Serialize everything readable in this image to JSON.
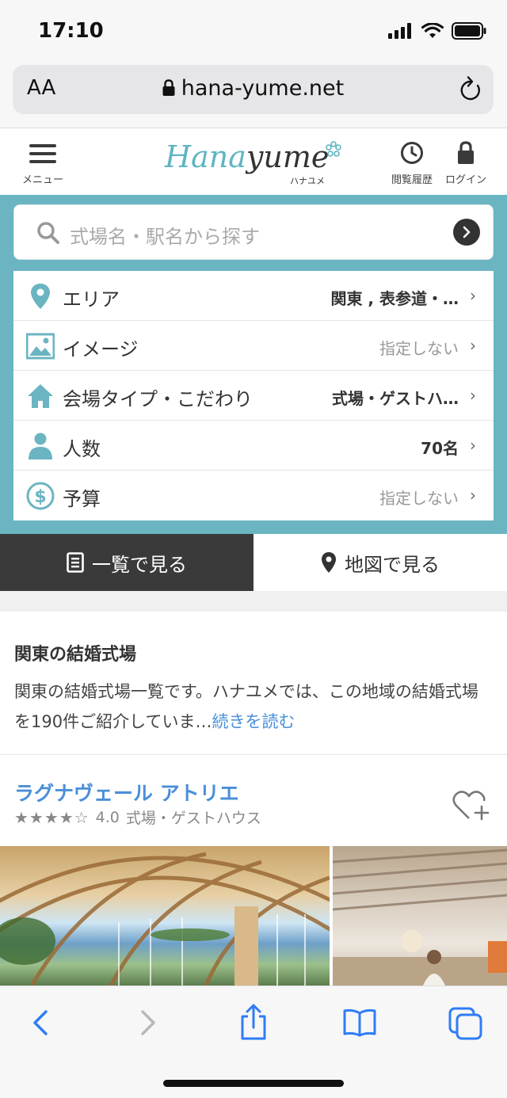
{
  "status_bar": {
    "time": "17:10"
  },
  "browser": {
    "text_size_label": "AA",
    "url": "hana-yume.net"
  },
  "site_header": {
    "menu_label": "メニュー",
    "logo_main": "Hana",
    "logo_accent": "yume",
    "logo_sub": "ハナユメ",
    "history_label": "閲覧履歴",
    "login_label": "ログイン"
  },
  "search": {
    "placeholder": "式場名・駅名から探す"
  },
  "filters": [
    {
      "label": "エリア",
      "value": "関東 , 表参道・…",
      "muted": false,
      "icon": "map-pin-icon"
    },
    {
      "label": "イメージ",
      "value": "指定しない",
      "muted": true,
      "icon": "image-icon"
    },
    {
      "label": "会場タイプ・こだわり",
      "value": "式場・ゲストハ…",
      "muted": false,
      "icon": "home-icon"
    },
    {
      "label": "人数",
      "value": "70名",
      "muted": false,
      "icon": "person-icon"
    },
    {
      "label": "予算",
      "value": "指定しない",
      "muted": true,
      "icon": "dollar-icon"
    }
  ],
  "tabs": {
    "list_label": "一覧で見る",
    "map_label": "地図で見る"
  },
  "intro": {
    "heading": "関東の結婚式場",
    "body": "関東の結婚式場一覧です。ハナユメでは、この地域の結婚式場を190件ご紹介していま…",
    "more_link": "続きを読む"
  },
  "venue": {
    "name": "ラグナヴェール アトリエ",
    "stars_display": "★★★★☆",
    "rating": "4.0",
    "type": "式場・ゲストハウス"
  },
  "colors": {
    "accent": "#6ab5c1",
    "link": "#4a8fd9",
    "ios_blue": "#2f7cf6"
  }
}
